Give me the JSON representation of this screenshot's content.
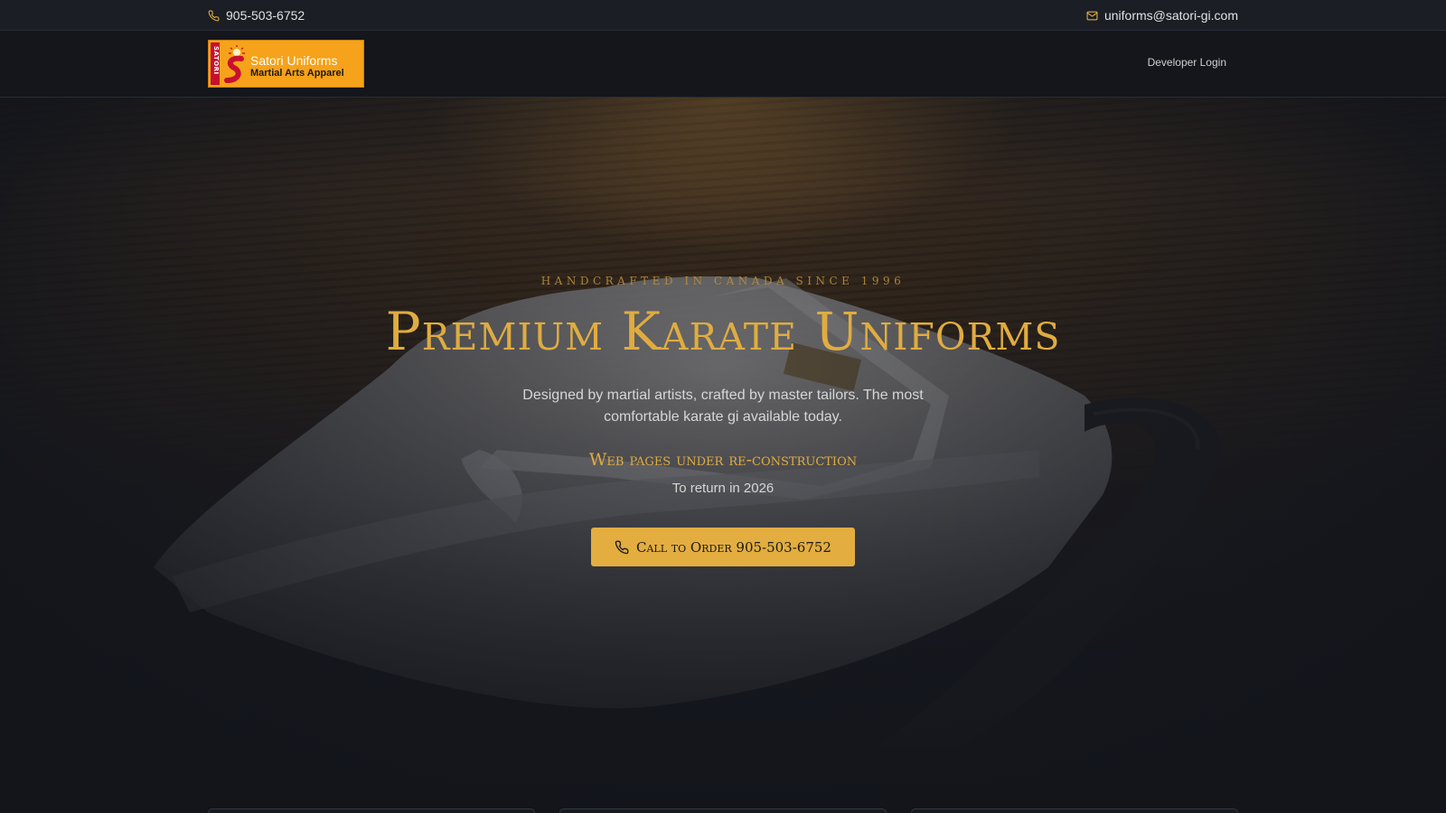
{
  "topbar": {
    "phone": "905-503-6752",
    "phone_icon": "phone-icon",
    "email": "uniforms@satori-gi.com",
    "email_icon": "mail-icon"
  },
  "nav": {
    "logo": {
      "vertical_text": "SATORI",
      "line1": "Satori Uniforms",
      "line2": "Martial Arts Apparel",
      "colors": {
        "background": "#f6a21a",
        "red": "#c8102e"
      }
    },
    "developer_login": "Developer Login"
  },
  "hero": {
    "eyebrow": "Handcrafted in Canada since 1996",
    "title": "Premium Karate Uniforms",
    "subtitle": "Designed by martial artists, crafted by master tailors. The most comfortable karate gi available today.",
    "notice": "Web pages under re-construction",
    "return_text": "To return in 2026",
    "cta_label": "Call to Order 905-503-6752",
    "cta_icon": "phone-icon"
  },
  "colors": {
    "accent": "#e0ac40",
    "background": "#13151b",
    "topbar": "#1b1e25"
  }
}
